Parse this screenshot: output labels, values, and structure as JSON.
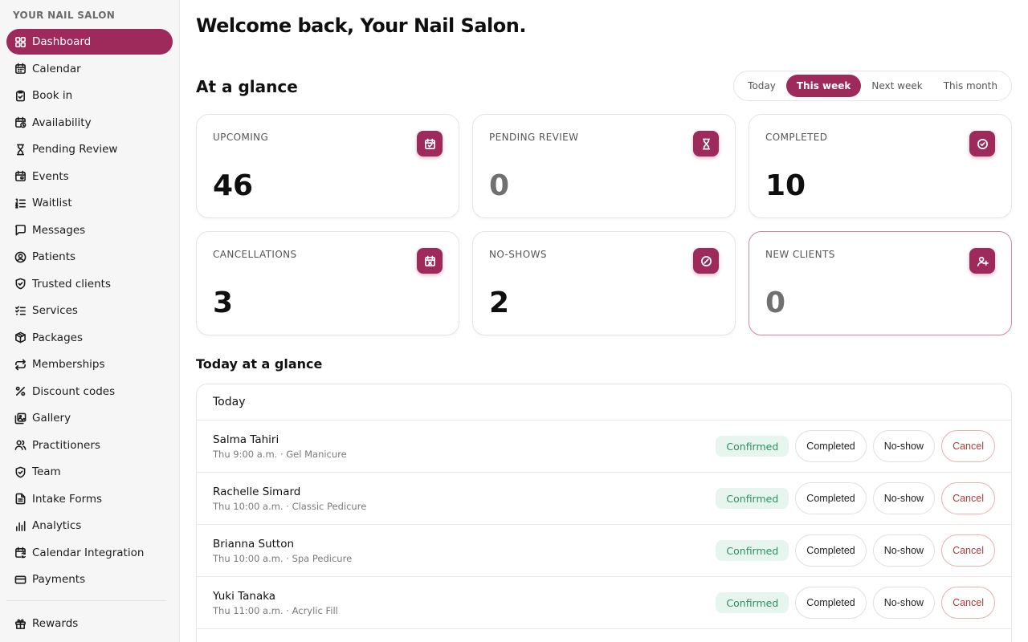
{
  "sidebar": {
    "brand": "YOUR NAIL SALON",
    "items": [
      {
        "label": "Dashboard",
        "icon": "grid-icon"
      },
      {
        "label": "Calendar",
        "icon": "calendar-icon"
      },
      {
        "label": "Book in",
        "icon": "clipboard-icon"
      },
      {
        "label": "Availability",
        "icon": "calendar-clock-icon"
      },
      {
        "label": "Pending Review",
        "icon": "hourglass-icon"
      },
      {
        "label": "Events",
        "icon": "calendar-event-icon"
      },
      {
        "label": "Waitlist",
        "icon": "list-ordered-icon"
      },
      {
        "label": "Messages",
        "icon": "message-icon"
      },
      {
        "label": "Patients",
        "icon": "user-circle-icon"
      },
      {
        "label": "Trusted clients",
        "icon": "shield-check-icon"
      },
      {
        "label": "Services",
        "icon": "list-checks-icon"
      },
      {
        "label": "Packages",
        "icon": "package-icon"
      },
      {
        "label": "Memberships",
        "icon": "repeat-icon"
      },
      {
        "label": "Discount codes",
        "icon": "percent-icon"
      },
      {
        "label": "Gallery",
        "icon": "gallery-icon"
      },
      {
        "label": "Practitioners",
        "icon": "users-icon"
      },
      {
        "label": "Team",
        "icon": "shield-icon"
      },
      {
        "label": "Intake Forms",
        "icon": "file-text-icon"
      },
      {
        "label": "Analytics",
        "icon": "bar-chart-icon"
      },
      {
        "label": "Calendar Integration",
        "icon": "calendar-sync-icon"
      },
      {
        "label": "Payments",
        "icon": "credit-card-icon"
      }
    ],
    "bottom_items": [
      {
        "label": "Rewards",
        "icon": "gift-icon"
      }
    ]
  },
  "header": {
    "welcome": "Welcome back, Your Nail Salon."
  },
  "glance": {
    "title": "At a glance",
    "ranges": [
      "Today",
      "This week",
      "Next week",
      "This month"
    ],
    "selected_range": "This week",
    "cards": [
      {
        "label": "UPCOMING",
        "value": "46",
        "icon": "calendar-check-icon"
      },
      {
        "label": "PENDING REVIEW",
        "value": "0",
        "icon": "hourglass-icon"
      },
      {
        "label": "COMPLETED",
        "value": "10",
        "icon": "check-circle-icon"
      },
      {
        "label": "CANCELLATIONS",
        "value": "3",
        "icon": "calendar-x-icon"
      },
      {
        "label": "NO-SHOWS",
        "value": "2",
        "icon": "ban-icon"
      },
      {
        "label": "NEW CLIENTS",
        "value": "0",
        "icon": "user-plus-icon"
      }
    ]
  },
  "today": {
    "heading": "Today at a glance",
    "panel_title": "Today",
    "status_label": "Confirmed",
    "actions": {
      "completed": "Completed",
      "no_show": "No-show",
      "cancel": "Cancel"
    },
    "appointments": [
      {
        "name": "Salma Tahiri",
        "meta": "Thu 9:00 a.m. · Gel Manicure"
      },
      {
        "name": "Rachelle Simard",
        "meta": "Thu 10:00 a.m. · Classic Pedicure"
      },
      {
        "name": "Brianna Sutton",
        "meta": "Thu 10:00 a.m. · Spa Pedicure"
      },
      {
        "name": "Yuki Tanaka",
        "meta": "Thu 11:00 a.m. · Acrylic Fill"
      }
    ]
  },
  "colors": {
    "brand": "#9e2a5b",
    "confirmed_bg": "#e6f5ee",
    "confirmed_text": "#2f8f5f",
    "cancel_text": "#b23a3a"
  }
}
